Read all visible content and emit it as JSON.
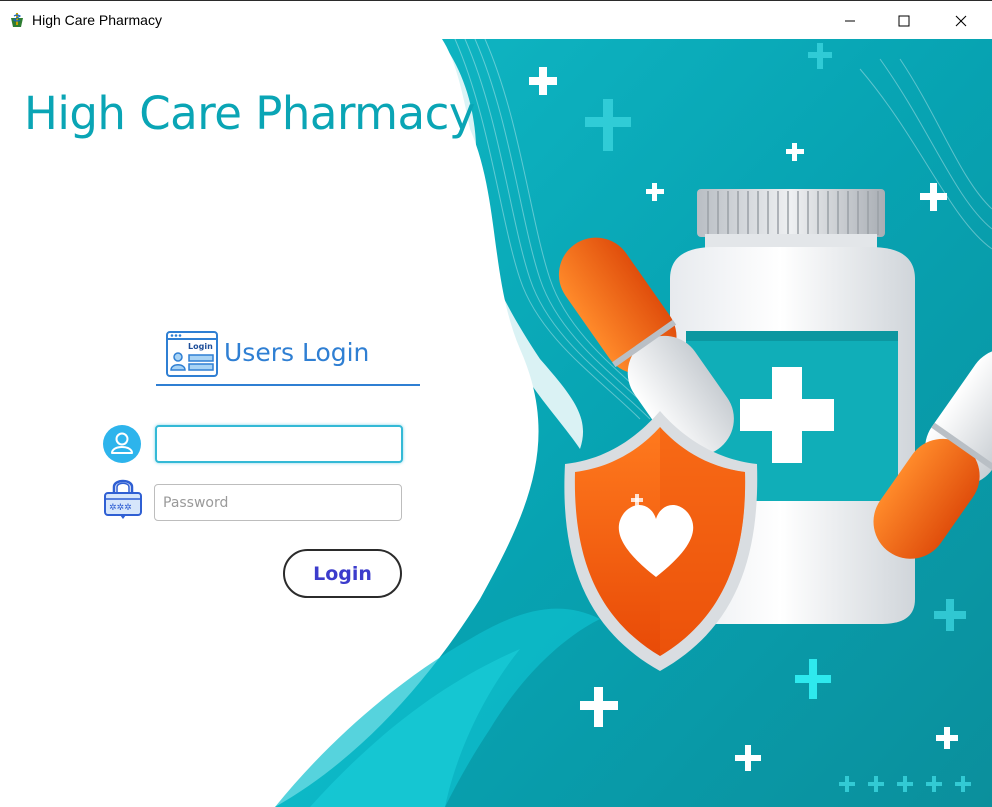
{
  "window": {
    "title": "High Care Pharmacy",
    "app_icon": "pharmacy-logo-icon",
    "controls": [
      "minimize-icon",
      "maximize-icon",
      "close-icon"
    ]
  },
  "brand": {
    "title": "High Care Pharmacy"
  },
  "login": {
    "header_icon": "login-window-icon",
    "header_icon_text": "Login",
    "title": "Users Login",
    "username": {
      "icon": "user-icon",
      "value": "",
      "placeholder": ""
    },
    "password": {
      "icon": "lock-icon",
      "value": "",
      "placeholder": "Password"
    },
    "button_label": "Login"
  },
  "colors": {
    "brand_teal": "#0aa5b5",
    "accent_blue": "#2f7fd3",
    "button_text": "#3c3ccc",
    "focus_border": "#34b9d6"
  }
}
